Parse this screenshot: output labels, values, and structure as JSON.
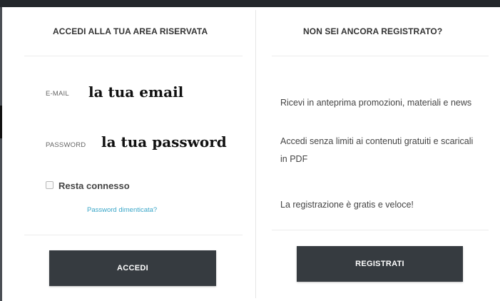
{
  "login": {
    "title": "ACCEDI ALLA TUA AREA RISERVATA",
    "email_label": "E-MAIL",
    "email_placeholder": "la tua email",
    "password_label": "PASSWORD",
    "password_placeholder": "la tua password",
    "remember_label": "Resta connesso",
    "remember_checked": false,
    "forgot_link": "Password dimenticata?",
    "submit_label": "ACCEDI"
  },
  "register": {
    "title": "NON SEI ANCORA REGISTRATO?",
    "benefit_1": "Ricevi in anteprima promozioni, materiali e news",
    "benefit_2": "Accedi senza limiti ai contenuti gratuiti e scaricali in PDF",
    "note": "La registrazione è gratis e veloce!",
    "submit_label": "REGISTRATI"
  },
  "colors": {
    "button_bg": "#363b40",
    "link": "#3aa6c8",
    "top_bar": "#23272b"
  }
}
